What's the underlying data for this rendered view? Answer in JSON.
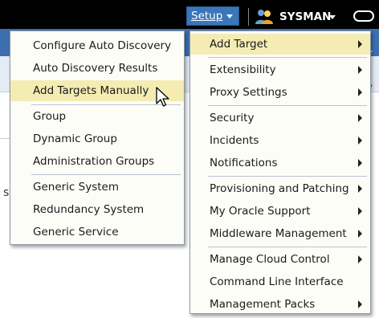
{
  "header": {
    "setup_label": "Setup",
    "user_name": "SYSMAN"
  },
  "background": {
    "left_fragment": "s"
  },
  "left_menu": {
    "items": [
      {
        "label": "Configure Auto Discovery"
      },
      {
        "label": "Auto Discovery Results"
      },
      {
        "label": "Add Targets Manually",
        "highlighted": true
      },
      {
        "label": "Group"
      },
      {
        "label": "Dynamic Group"
      },
      {
        "label": "Administration Groups"
      },
      {
        "label": "Generic System"
      },
      {
        "label": "Redundancy System"
      },
      {
        "label": "Generic Service"
      }
    ]
  },
  "right_menu": {
    "items": [
      {
        "label": "Add Target",
        "submenu": true,
        "highlighted": true
      },
      {
        "label": "Extensibility",
        "submenu": true
      },
      {
        "label": "Proxy Settings",
        "submenu": true
      },
      {
        "label": "Security",
        "submenu": true
      },
      {
        "label": "Incidents",
        "submenu": true
      },
      {
        "label": "Notifications",
        "submenu": true
      },
      {
        "label": "Provisioning and Patching",
        "submenu": true
      },
      {
        "label": "My Oracle Support",
        "submenu": true
      },
      {
        "label": "Middleware Management",
        "submenu": true
      },
      {
        "label": "Manage Cloud Control",
        "submenu": true
      },
      {
        "label": "Command Line Interface",
        "submenu": false
      },
      {
        "label": "Management Packs",
        "submenu": true
      }
    ]
  },
  "colors": {
    "header_bg": "#000000",
    "setup_button_bg": "#3a76b8",
    "highlight_bg": "#f4ecb2",
    "menu_bg": "#fdfdf8"
  },
  "icons": [
    "chevron-down-icon",
    "user-icon",
    "pill-icon",
    "submenu-arrow-icon",
    "mouse-cursor-icon"
  ]
}
